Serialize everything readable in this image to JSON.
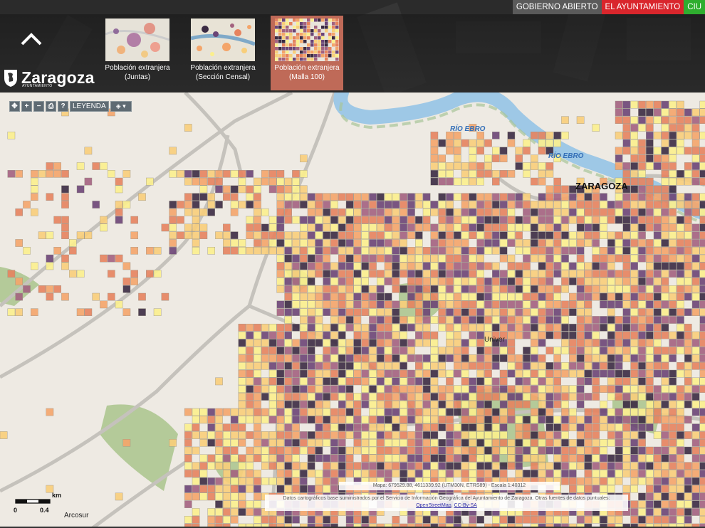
{
  "topnav": {
    "items": [
      {
        "label": "GOBIERNO ABIERTO",
        "color": "#5a5a5a"
      },
      {
        "label": "EL AYUNTAMIENTO",
        "color": "#d9262c"
      },
      {
        "label": "CIU",
        "color": "#2fae2f"
      }
    ]
  },
  "header": {
    "logo_text": "Zaragoza",
    "logo_sub": "AYUNTAMIENTO",
    "collapse_icon": "chevron-up-icon",
    "layers": [
      {
        "title": "Población extranjera",
        "subtitle": "(Juntas)",
        "active": false
      },
      {
        "title": "Población extranjera",
        "subtitle": "(Sección Censal)",
        "active": false
      },
      {
        "title": "Población extranjera",
        "subtitle": "(Malla 100)",
        "active": true
      }
    ]
  },
  "toolbar": {
    "legend_label": "LEYENDA",
    "icons": [
      "pan-icon",
      "zoom-in-icon",
      "zoom-out-icon",
      "print-icon",
      "help-icon",
      "layers-icon"
    ]
  },
  "map": {
    "colors": {
      "class1": "#fbef8d",
      "class2": "#f8ce7a",
      "class3": "#f4a56a",
      "class4": "#e6835e",
      "class5": "#a3627f",
      "class6": "#6b4576",
      "class7": "#3b2b43",
      "park": "#a9c48c",
      "river": "#9ec8e6",
      "road": "#c9c6c1"
    },
    "labels": [
      {
        "text": "ZARAGOZA",
        "kind": "city"
      },
      {
        "text": "RÍO EBRO",
        "kind": "river"
      },
      {
        "text": "RÍO EBRO",
        "kind": "river"
      },
      {
        "text": "Univer",
        "kind": "place"
      },
      {
        "text": "Arcosur",
        "kind": "place"
      }
    ]
  },
  "coords_text": "Mapa: 679529.88, 4611339.92 (UTM30N, ETRS89) - Escala 1:40312",
  "attribution": {
    "text": "Datos cartográficos base suministrados por el Servicio de Información Geográfica del Ayuntamiento de Zaragoza. Otras fuentes de datos puntuales:",
    "link1": "OpenStreetMap",
    "link2": "CC-By-SA"
  },
  "scale": {
    "unit": "km",
    "ticks": [
      "0",
      "0.4"
    ]
  }
}
